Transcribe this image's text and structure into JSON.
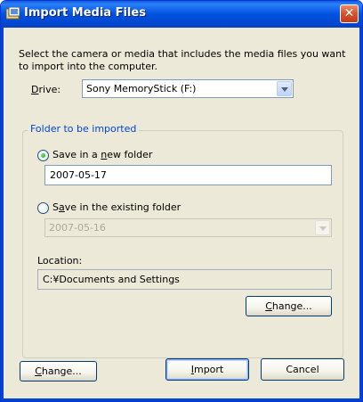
{
  "window": {
    "title": "Import Media Files",
    "close_glyph": "✕"
  },
  "instructions": "Select the camera or media that includes the media files you want to import into the computer.",
  "drive": {
    "label_mnemonic": "D",
    "label_rest": "rive:",
    "selected": "Sony MemoryStick (F:)"
  },
  "group": {
    "title": "Folder to be imported",
    "new_folder": {
      "label_pre": "Save in a ",
      "label_mnemonic": "n",
      "label_post": "ew folder",
      "checked": true,
      "value": "2007-05-17"
    },
    "existing_folder": {
      "label_pre": "S",
      "label_mnemonic": "a",
      "label_post": "ve in the existing folder",
      "checked": false,
      "selected": "2007-05-16",
      "enabled": false
    },
    "location": {
      "label": "Location:",
      "value": "C:¥Documents and Settings",
      "change_pre": "",
      "change_mnemonic": "C",
      "change_post": "hange..."
    }
  },
  "footer": {
    "change_pre": "",
    "change_mnemonic": "C",
    "change_post": "hange...",
    "import_pre": "",
    "import_mnemonic": "I",
    "import_post": "mport",
    "cancel": "Cancel"
  },
  "colors": {
    "titlebar": "#0052e0",
    "group_title": "#0046d5",
    "face": "#ece9d8"
  }
}
